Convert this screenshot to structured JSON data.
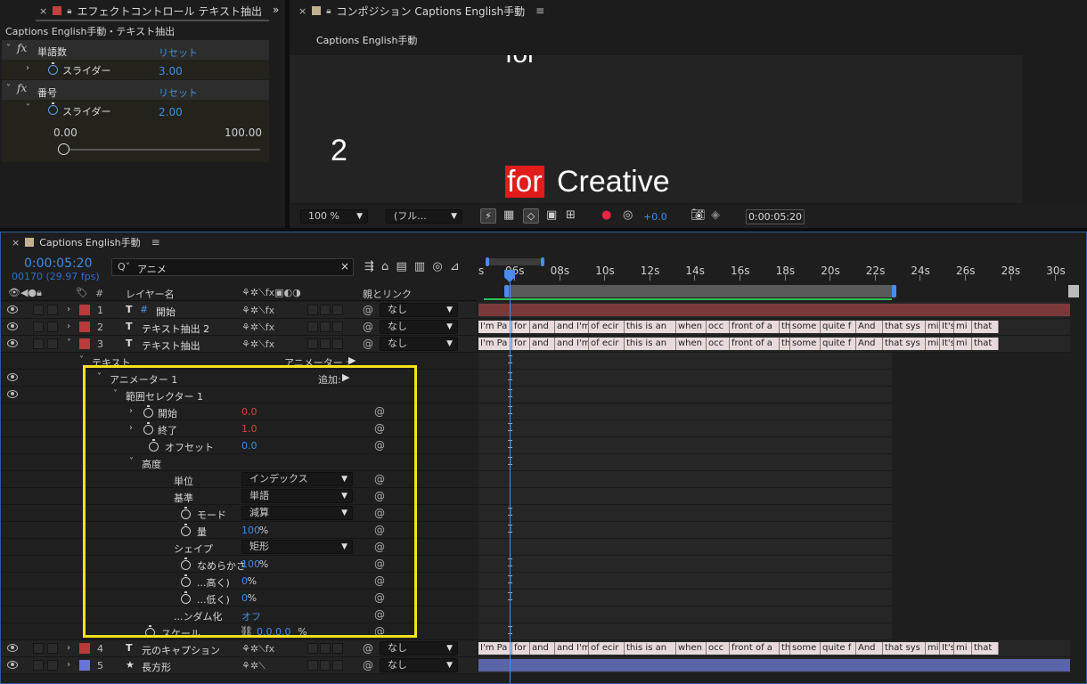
{
  "effect_panel": {
    "tab_title": "エフェクトコントロール テキスト抽出",
    "breadcrumb": "Captions English手動・テキスト抽出",
    "effects": [
      {
        "fx": "fx",
        "name": "単語数",
        "reset": "リセット",
        "param_label": "スライダー",
        "value": "3.00"
      },
      {
        "fx": "fx",
        "name": "番号",
        "reset": "リセット",
        "param_label": "スライダー",
        "value": "2.00",
        "slider_min": "0.00",
        "slider_max": "100.00"
      }
    ]
  },
  "comp_panel": {
    "tab_title": "コンポジション Captions English手動",
    "comp_tab": "Captions English手動",
    "canvas": {
      "top_text": "for",
      "number_text": "2",
      "highlight_word": "for",
      "caption_word": "Creative"
    },
    "toolbar": {
      "zoom": "100 %",
      "resolution": "(フル...",
      "exposure": "+0.0",
      "timecode": "0:00:05:20"
    }
  },
  "timeline": {
    "tab_title": "Captions English手動",
    "timecode": "0:00:05:20",
    "frame_info": "00170 (29.97 fps)",
    "search_value": "アニメ",
    "search_prefix": "Q˅",
    "headers": {
      "num": "#",
      "layer_name": "レイヤー名",
      "parent": "親とリンク"
    },
    "ruler_ticks": [
      "s",
      "06s",
      "08s",
      "10s",
      "12s",
      "14s",
      "16s",
      "18s",
      "20s",
      "22s",
      "24s",
      "26s",
      "28s",
      "30s"
    ],
    "layers": [
      {
        "num": "1",
        "type_icon": "T",
        "name": "開始",
        "name_icon": "#",
        "parent": "なし",
        "color": "#b83a3a"
      },
      {
        "num": "2",
        "type_icon": "T",
        "name": "テキスト抽出 2",
        "parent": "なし",
        "color": "#b83a3a"
      },
      {
        "num": "3",
        "type_icon": "T",
        "name": "テキスト抽出",
        "parent": "なし",
        "color": "#b83a3a"
      },
      {
        "num": "4",
        "type_icon": "T",
        "name": "元のキャプション",
        "parent": "なし",
        "color": "#b83a3a"
      },
      {
        "num": "5",
        "type_icon": "★",
        "name": "長方形",
        "parent": "なし",
        "color": "#6a74d8"
      }
    ],
    "props": {
      "text": "テキスト",
      "animator_label": "アニメーター :",
      "animator1": "アニメーター 1",
      "add_label": "追加:",
      "range_selector": "範囲セレクター 1",
      "start": {
        "label": "開始",
        "value": "0.0"
      },
      "end": {
        "label": "終了",
        "value": "1.0"
      },
      "offset": {
        "label": "オフセット",
        "value": "0.0"
      },
      "advanced": "高度",
      "units": {
        "label": "単位",
        "value": "インデックス"
      },
      "based_on": {
        "label": "基準",
        "value": "単語"
      },
      "mode": {
        "label": "モード",
        "value": "減算"
      },
      "amount": {
        "label": "量",
        "value": "100",
        "unit": "%"
      },
      "shape": {
        "label": "シェイプ",
        "value": "矩形"
      },
      "smoothness": {
        "label": "なめらかさ",
        "value": "100",
        "unit": "%"
      },
      "ease_high": {
        "label": "...高く)",
        "value": "0",
        "unit": "%"
      },
      "ease_low": {
        "label": "...低く)",
        "value": "0",
        "unit": "%"
      },
      "randomize": {
        "label": "...ンダム化",
        "value": "オフ"
      },
      "scale": {
        "label": "スケール",
        "value": "0.0,0.0",
        "unit": "%"
      }
    },
    "caption_segments": [
      "I'm Pa",
      "for",
      "and",
      "and I'm",
      "of ecir",
      "this is an",
      "when",
      "occ",
      "front of a",
      "th",
      "some",
      "quite f",
      "And",
      "that sys",
      "mi",
      "It's",
      "mi",
      "that"
    ]
  },
  "colors": {
    "accent": "#3d8de6",
    "highlight": "#e21b1b",
    "selection": "#f5e11a"
  }
}
